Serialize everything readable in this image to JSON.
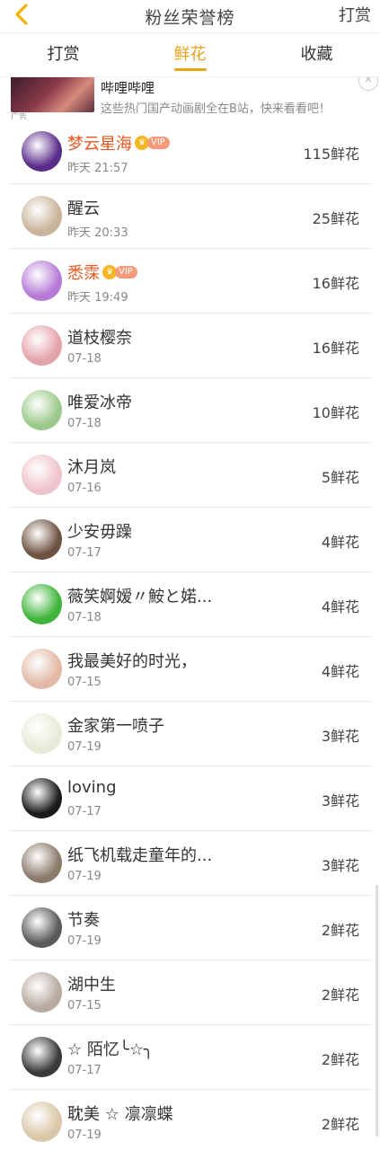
{
  "header": {
    "title": "粉丝荣誉榜",
    "action_label": "打赏"
  },
  "tabs": [
    {
      "label": "打赏",
      "active": false
    },
    {
      "label": "鲜花",
      "active": true
    },
    {
      "label": "收藏",
      "active": false
    }
  ],
  "ad": {
    "tag": "广告",
    "title": "哔哩哔哩",
    "description": "这些热门国产动画剧全在B站，快来看看吧！",
    "close_icon": "close-icon"
  },
  "colors": {
    "accent": "#e8a317",
    "vip_name": "#e8561e"
  },
  "rows": [
    {
      "name": "梦云星海",
      "date": "昨天 21:57",
      "amount": "115鲜花",
      "vip": true,
      "vip_label": "VIP",
      "avatar_color": "#5a2d8a"
    },
    {
      "name": "醒云",
      "date": "昨天 20:33",
      "amount": "25鲜花",
      "vip": false,
      "avatar_color": "#c8b49a"
    },
    {
      "name": "悉霂",
      "date": "昨天 19:49",
      "amount": "16鲜花",
      "vip": true,
      "vip_label": "VIP",
      "avatar_color": "#b57ad6"
    },
    {
      "name": "道枝樱奈",
      "date": "07-18",
      "amount": "16鲜花",
      "vip": false,
      "avatar_color": "#e3a3aa"
    },
    {
      "name": "唯爱冰帝",
      "date": "07-18",
      "amount": "10鲜花",
      "vip": false,
      "avatar_color": "#9cc98a"
    },
    {
      "name": "沐月岚",
      "date": "07-16",
      "amount": "5鲜花",
      "vip": false,
      "avatar_color": "#efc3cb"
    },
    {
      "name": "少安毋躁",
      "date": "07-17",
      "amount": "4鲜花",
      "vip": false,
      "avatar_color": "#6e5240"
    },
    {
      "name": "薇笑婀嫒〃鮟と婼...",
      "date": "07-18",
      "amount": "4鲜花",
      "vip": false,
      "avatar_color": "#3fb43a"
    },
    {
      "name": "我最美好的时光，",
      "date": "07-15",
      "amount": "4鲜花",
      "vip": false,
      "avatar_color": "#e2b9a6"
    },
    {
      "name": "金家第一喷子",
      "date": "07-19",
      "amount": "3鲜花",
      "vip": false,
      "avatar_color": "#e8ead8"
    },
    {
      "name": "loving",
      "date": "07-17",
      "amount": "3鲜花",
      "vip": false,
      "avatar_color": "#1c1c1c"
    },
    {
      "name": "纸飞机载走童年的...",
      "date": "07-19",
      "amount": "3鲜花",
      "vip": false,
      "avatar_color": "#8a7a6a"
    },
    {
      "name": "节奏",
      "date": "07-19",
      "amount": "2鲜花",
      "vip": false,
      "avatar_color": "#5a5a5a"
    },
    {
      "name": "湖中生",
      "date": "07-15",
      "amount": "2鲜花",
      "vip": false,
      "avatar_color": "#b7aaa0"
    },
    {
      "name": "☆ 陌忆╰☆╮",
      "date": "07-17",
      "amount": "2鲜花",
      "vip": false,
      "avatar_color": "#3a3a3a"
    },
    {
      "name": "耽美 ☆ 凛凛蝶",
      "date": "07-19",
      "amount": "2鲜花",
      "vip": false,
      "avatar_color": "#d9c7a8"
    }
  ]
}
